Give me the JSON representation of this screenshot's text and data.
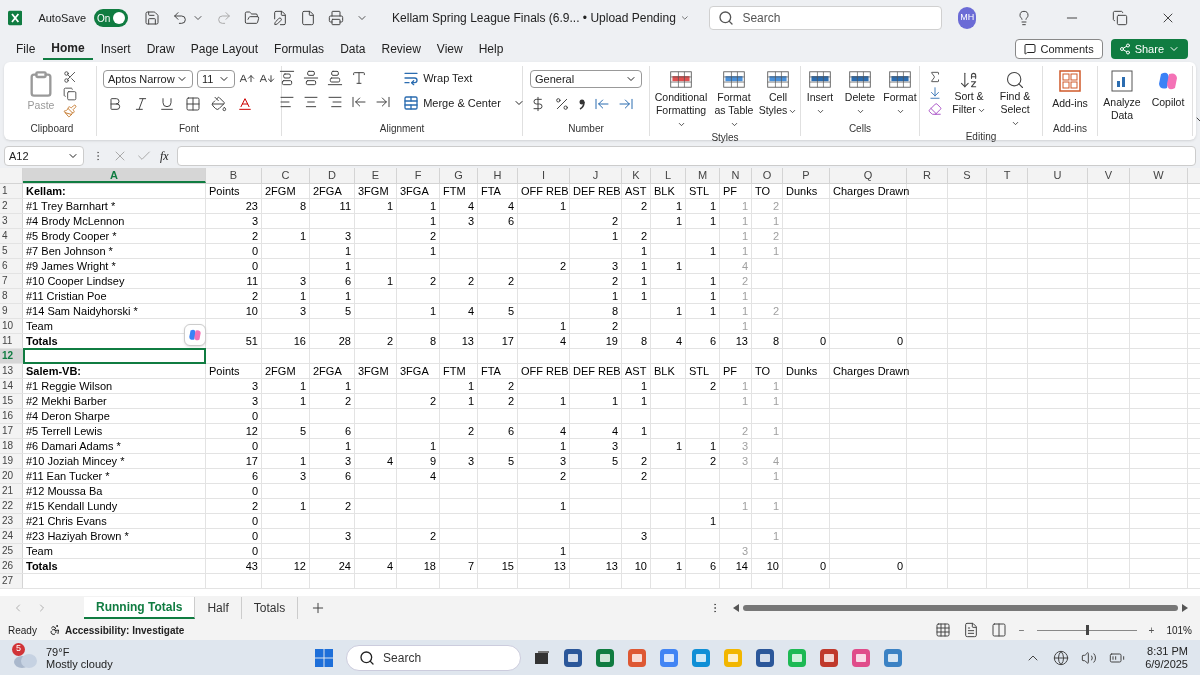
{
  "window": {
    "title": "Kellam Spring League Finals (6.9... • Upload Pending",
    "autosave": {
      "label": "AutoSave",
      "on": true,
      "state_label": "On"
    },
    "search": {
      "placeholder": "Search"
    },
    "user_initials": "MH"
  },
  "menu": [
    {
      "label": "File",
      "selected": false
    },
    {
      "label": "Home",
      "selected": true
    },
    {
      "label": "Insert",
      "selected": false
    },
    {
      "label": "Draw",
      "selected": false
    },
    {
      "label": "Page Layout",
      "selected": false
    },
    {
      "label": "Formulas",
      "selected": false
    },
    {
      "label": "Data",
      "selected": false
    },
    {
      "label": "Review",
      "selected": false
    },
    {
      "label": "View",
      "selected": false
    },
    {
      "label": "Help",
      "selected": false
    }
  ],
  "menu_buttons": {
    "comments": "Comments",
    "share": "Share"
  },
  "ribbon": {
    "groups": [
      {
        "kind": "clipboard",
        "label": "Clipboard",
        "paste": "Paste"
      },
      {
        "kind": "font",
        "label": "Font",
        "font_name": "Aptos Narrow",
        "font_size": "11"
      },
      {
        "kind": "alignment",
        "label": "Alignment",
        "wrap": "Wrap Text",
        "merge": "Merge & Center"
      },
      {
        "kind": "number",
        "label": "Number",
        "format": "General"
      },
      {
        "kind": "styles",
        "label": "Styles",
        "buttons": [
          "Conditional Formatting",
          "Format as Table",
          "Cell Styles"
        ]
      },
      {
        "kind": "cells",
        "label": "Cells",
        "buttons": [
          "Insert",
          "Delete",
          "Format"
        ]
      },
      {
        "kind": "editing",
        "label": "Editing",
        "buttons": [
          "Sort & Filter",
          "Find & Select"
        ]
      },
      {
        "kind": "addins",
        "label": "Add-ins",
        "buttons": [
          "Add-ins"
        ]
      },
      {
        "kind": "copilot",
        "buttons": [
          "Analyze Data",
          "Copilot"
        ]
      }
    ]
  },
  "formula_bar": {
    "name_box": "A12",
    "fx": "fx"
  },
  "columns": [
    {
      "letter": "A",
      "selected": true
    },
    {
      "letter": "B",
      "selected": false
    },
    {
      "letter": "C",
      "selected": false
    },
    {
      "letter": "D",
      "selected": false
    },
    {
      "letter": "E",
      "selected": false
    },
    {
      "letter": "F",
      "selected": false
    },
    {
      "letter": "G",
      "selected": false
    },
    {
      "letter": "H",
      "selected": false
    },
    {
      "letter": "I",
      "selected": false
    },
    {
      "letter": "J",
      "selected": false
    },
    {
      "letter": "K",
      "selected": false
    },
    {
      "letter": "L",
      "selected": false
    },
    {
      "letter": "M",
      "selected": false
    },
    {
      "letter": "N",
      "selected": false
    },
    {
      "letter": "O",
      "selected": false
    },
    {
      "letter": "P",
      "selected": false
    },
    {
      "letter": "Q",
      "selected": false
    },
    {
      "letter": "R",
      "selected": false
    },
    {
      "letter": "S",
      "selected": false
    },
    {
      "letter": "T",
      "selected": false
    },
    {
      "letter": "U",
      "selected": false
    },
    {
      "letter": "V",
      "selected": false
    },
    {
      "letter": "W",
      "selected": false
    }
  ],
  "rows": [
    {
      "n": "1",
      "kind": "header",
      "selected": false,
      "cells": [
        {
          "text": "Kellam:",
          "dim": false
        },
        {
          "text": "Points",
          "dim": false
        },
        {
          "text": "2FGM",
          "dim": false
        },
        {
          "text": "2FGA",
          "dim": false
        },
        {
          "text": "3FGM",
          "dim": false
        },
        {
          "text": "3FGA",
          "dim": false
        },
        {
          "text": "FTM",
          "dim": false
        },
        {
          "text": "FTA",
          "dim": false
        },
        {
          "text": "OFF REB",
          "dim": false
        },
        {
          "text": "DEF REB",
          "dim": false
        },
        {
          "text": "AST",
          "dim": false
        },
        {
          "text": "BLK",
          "dim": false
        },
        {
          "text": "STL",
          "dim": false
        },
        {
          "text": "PF",
          "dim": false
        },
        {
          "text": "TO",
          "dim": false
        },
        {
          "text": "Dunks",
          "dim": false
        },
        {
          "text": "Charges Drawn",
          "dim": false
        }
      ]
    },
    {
      "n": "2",
      "kind": "player",
      "selected": false,
      "cells": [
        {
          "text": "#1 Trey Barnhart *",
          "dim": false
        },
        {
          "text": "23",
          "dim": false
        },
        {
          "text": "8",
          "dim": false
        },
        {
          "text": "11",
          "dim": false
        },
        {
          "text": "1",
          "dim": false
        },
        {
          "text": "1",
          "dim": false
        },
        {
          "text": "4",
          "dim": false
        },
        {
          "text": "4",
          "dim": false
        },
        {
          "text": "1",
          "dim": false
        },
        null,
        {
          "text": "2",
          "dim": false
        },
        {
          "text": "1",
          "dim": false
        },
        {
          "text": "1",
          "dim": false
        },
        {
          "text": "1",
          "dim": true
        },
        {
          "text": "2",
          "dim": true
        }
      ]
    },
    {
      "n": "3",
      "kind": "player",
      "selected": false,
      "cells": [
        {
          "text": "#4 Brody McLennon",
          "dim": false
        },
        {
          "text": "3",
          "dim": false
        },
        null,
        null,
        null,
        {
          "text": "1",
          "dim": false
        },
        {
          "text": "3",
          "dim": false
        },
        {
          "text": "6",
          "dim": false
        },
        null,
        {
          "text": "2",
          "dim": false
        },
        null,
        {
          "text": "1",
          "dim": false
        },
        {
          "text": "1",
          "dim": false
        },
        {
          "text": "1",
          "dim": true
        },
        {
          "text": "1",
          "dim": true
        }
      ]
    },
    {
      "n": "4",
      "kind": "player",
      "selected": false,
      "cells": [
        {
          "text": "#5 Brody Cooper *",
          "dim": false
        },
        {
          "text": "2",
          "dim": false
        },
        {
          "text": "1",
          "dim": false
        },
        {
          "text": "3",
          "dim": false
        },
        null,
        {
          "text": "2",
          "dim": false
        },
        null,
        null,
        null,
        {
          "text": "1",
          "dim": false
        },
        {
          "text": "2",
          "dim": false
        },
        null,
        null,
        {
          "text": "1",
          "dim": true
        },
        {
          "text": "2",
          "dim": true
        }
      ]
    },
    {
      "n": "5",
      "kind": "player",
      "selected": false,
      "cells": [
        {
          "text": "#7 Ben Johnson *",
          "dim": false
        },
        {
          "text": "0",
          "dim": false
        },
        null,
        {
          "text": "1",
          "dim": false
        },
        null,
        {
          "text": "1",
          "dim": false
        },
        null,
        null,
        null,
        null,
        {
          "text": "1",
          "dim": false
        },
        null,
        {
          "text": "1",
          "dim": false
        },
        {
          "text": "1",
          "dim": true
        },
        {
          "text": "1",
          "dim": true
        }
      ]
    },
    {
      "n": "6",
      "kind": "player",
      "selected": false,
      "cells": [
        {
          "text": "#9 James Wright *",
          "dim": false
        },
        {
          "text": "0",
          "dim": false
        },
        null,
        {
          "text": "1",
          "dim": false
        },
        null,
        null,
        null,
        null,
        {
          "text": "2",
          "dim": false
        },
        {
          "text": "3",
          "dim": false
        },
        {
          "text": "1",
          "dim": false
        },
        {
          "text": "1",
          "dim": false
        },
        null,
        {
          "text": "4",
          "dim": true
        }
      ]
    },
    {
      "n": "7",
      "kind": "player",
      "selected": false,
      "cells": [
        {
          "text": "#10 Cooper Lindsey",
          "dim": false
        },
        {
          "text": "11",
          "dim": false
        },
        {
          "text": "3",
          "dim": false
        },
        {
          "text": "6",
          "dim": false
        },
        {
          "text": "1",
          "dim": false
        },
        {
          "text": "2",
          "dim": false
        },
        {
          "text": "2",
          "dim": false
        },
        {
          "text": "2",
          "dim": false
        },
        null,
        {
          "text": "2",
          "dim": false
        },
        {
          "text": "1",
          "dim": false
        },
        null,
        {
          "text": "1",
          "dim": false
        },
        {
          "text": "2",
          "dim": true
        }
      ]
    },
    {
      "n": "8",
      "kind": "player",
      "selected": false,
      "cells": [
        {
          "text": "#11 Cristian Poe",
          "dim": false
        },
        {
          "text": "2",
          "dim": false
        },
        {
          "text": "1",
          "dim": false
        },
        {
          "text": "1",
          "dim": false
        },
        null,
        null,
        null,
        null,
        null,
        {
          "text": "1",
          "dim": false
        },
        {
          "text": "1",
          "dim": false
        },
        null,
        {
          "text": "1",
          "dim": false
        },
        {
          "text": "1",
          "dim": true
        }
      ]
    },
    {
      "n": "9",
      "kind": "player",
      "selected": false,
      "cells": [
        {
          "text": "#14 Sam Naidyhorski *",
          "dim": false
        },
        {
          "text": "10",
          "dim": false
        },
        {
          "text": "3",
          "dim": false
        },
        {
          "text": "5",
          "dim": false
        },
        null,
        {
          "text": "1",
          "dim": false
        },
        {
          "text": "4",
          "dim": false
        },
        {
          "text": "5",
          "dim": false
        },
        null,
        {
          "text": "8",
          "dim": false
        },
        null,
        {
          "text": "1",
          "dim": false
        },
        {
          "text": "1",
          "dim": false
        },
        {
          "text": "1",
          "dim": true
        },
        {
          "text": "2",
          "dim": true
        }
      ]
    },
    {
      "n": "10",
      "kind": "player",
      "selected": false,
      "cells": [
        {
          "text": "Team",
          "dim": false
        },
        null,
        null,
        null,
        null,
        null,
        null,
        null,
        {
          "text": "1",
          "dim": false
        },
        {
          "text": "2",
          "dim": false
        },
        null,
        null,
        null,
        {
          "text": "1",
          "dim": true
        }
      ]
    },
    {
      "n": "11",
      "kind": "totals",
      "selected": false,
      "cells": [
        {
          "text": "Totals",
          "dim": false
        },
        {
          "text": "51",
          "dim": false
        },
        {
          "text": "16",
          "dim": false
        },
        {
          "text": "28",
          "dim": false
        },
        {
          "text": "2",
          "dim": false
        },
        {
          "text": "8",
          "dim": false
        },
        {
          "text": "13",
          "dim": false
        },
        {
          "text": "17",
          "dim": false
        },
        {
          "text": "4",
          "dim": false
        },
        {
          "text": "19",
          "dim": false
        },
        {
          "text": "8",
          "dim": false
        },
        {
          "text": "4",
          "dim": false
        },
        {
          "text": "6",
          "dim": false
        },
        {
          "text": "13",
          "dim": false
        },
        {
          "text": "8",
          "dim": false
        },
        {
          "text": "0",
          "dim": false
        },
        {
          "text": "0",
          "dim": false
        }
      ]
    },
    {
      "n": "12",
      "kind": "blank",
      "selected": true
    },
    {
      "n": "13",
      "kind": "header",
      "selected": false,
      "cells": [
        {
          "text": "Salem-VB:",
          "dim": false
        },
        {
          "text": "Points",
          "dim": false
        },
        {
          "text": "2FGM",
          "dim": false
        },
        {
          "text": "2FGA",
          "dim": false
        },
        {
          "text": "3FGM",
          "dim": false
        },
        {
          "text": "3FGA",
          "dim": false
        },
        {
          "text": "FTM",
          "dim": false
        },
        {
          "text": "FTA",
          "dim": false
        },
        {
          "text": "OFF REB",
          "dim": false
        },
        {
          "text": "DEF REB",
          "dim": false
        },
        {
          "text": "AST",
          "dim": false
        },
        {
          "text": "BLK",
          "dim": false
        },
        {
          "text": "STL",
          "dim": false
        },
        {
          "text": "PF",
          "dim": false
        },
        {
          "text": "TO",
          "dim": false
        },
        {
          "text": "Dunks",
          "dim": false
        },
        {
          "text": "Charges Drawn",
          "dim": false
        }
      ]
    },
    {
      "n": "14",
      "kind": "player",
      "selected": false,
      "cells": [
        {
          "text": "#1 Reggie Wilson",
          "dim": false
        },
        {
          "text": "3",
          "dim": false
        },
        {
          "text": "1",
          "dim": false
        },
        {
          "text": "1",
          "dim": false
        },
        null,
        null,
        {
          "text": "1",
          "dim": false
        },
        {
          "text": "2",
          "dim": false
        },
        null,
        null,
        {
          "text": "1",
          "dim": false
        },
        null,
        {
          "text": "2",
          "dim": false
        },
        {
          "text": "1",
          "dim": true
        },
        {
          "text": "1",
          "dim": true
        }
      ]
    },
    {
      "n": "15",
      "kind": "player",
      "selected": false,
      "cells": [
        {
          "text": "#2 Mekhi Barber",
          "dim": false
        },
        {
          "text": "3",
          "dim": false
        },
        {
          "text": "1",
          "dim": false
        },
        {
          "text": "2",
          "dim": false
        },
        null,
        {
          "text": "2",
          "dim": false
        },
        {
          "text": "1",
          "dim": false
        },
        {
          "text": "2",
          "dim": false
        },
        {
          "text": "1",
          "dim": false
        },
        {
          "text": "1",
          "dim": false
        },
        {
          "text": "1",
          "dim": false
        },
        null,
        null,
        {
          "text": "1",
          "dim": true
        },
        {
          "text": "1",
          "dim": true
        }
      ]
    },
    {
      "n": "16",
      "kind": "player",
      "selected": false,
      "cells": [
        {
          "text": "#4 Deron Sharpe",
          "dim": false
        },
        {
          "text": "0",
          "dim": false
        }
      ]
    },
    {
      "n": "17",
      "kind": "player",
      "selected": false,
      "cells": [
        {
          "text": "#5 Terrell Lewis",
          "dim": false
        },
        {
          "text": "12",
          "dim": false
        },
        {
          "text": "5",
          "dim": false
        },
        {
          "text": "6",
          "dim": false
        },
        null,
        null,
        {
          "text": "2",
          "dim": false
        },
        {
          "text": "6",
          "dim": false
        },
        {
          "text": "4",
          "dim": false
        },
        {
          "text": "4",
          "dim": false
        },
        {
          "text": "1",
          "dim": false
        },
        null,
        null,
        {
          "text": "2",
          "dim": true
        },
        {
          "text": "1",
          "dim": true
        }
      ]
    },
    {
      "n": "18",
      "kind": "player",
      "selected": false,
      "cells": [
        {
          "text": "#6 Damari Adams *",
          "dim": false
        },
        {
          "text": "0",
          "dim": false
        },
        null,
        {
          "text": "1",
          "dim": false
        },
        null,
        {
          "text": "1",
          "dim": false
        },
        null,
        null,
        {
          "text": "1",
          "dim": false
        },
        {
          "text": "3",
          "dim": false
        },
        null,
        {
          "text": "1",
          "dim": false
        },
        {
          "text": "1",
          "dim": false
        },
        {
          "text": "3",
          "dim": true
        }
      ]
    },
    {
      "n": "19",
      "kind": "player",
      "selected": false,
      "cells": [
        {
          "text": "#10 Joziah Mincey *",
          "dim": false
        },
        {
          "text": "17",
          "dim": false
        },
        {
          "text": "1",
          "dim": false
        },
        {
          "text": "3",
          "dim": false
        },
        {
          "text": "4",
          "dim": false
        },
        {
          "text": "9",
          "dim": false
        },
        {
          "text": "3",
          "dim": false
        },
        {
          "text": "5",
          "dim": false
        },
        {
          "text": "3",
          "dim": false
        },
        {
          "text": "5",
          "dim": false
        },
        {
          "text": "2",
          "dim": false
        },
        null,
        {
          "text": "2",
          "dim": false
        },
        {
          "text": "3",
          "dim": true
        },
        {
          "text": "4",
          "dim": true
        }
      ]
    },
    {
      "n": "20",
      "kind": "player",
      "selected": false,
      "cells": [
        {
          "text": "#11 Ean Tucker *",
          "dim": false
        },
        {
          "text": "6",
          "dim": false
        },
        {
          "text": "3",
          "dim": false
        },
        {
          "text": "6",
          "dim": false
        },
        null,
        {
          "text": "4",
          "dim": false
        },
        null,
        null,
        {
          "text": "2",
          "dim": false
        },
        null,
        {
          "text": "2",
          "dim": false
        },
        null,
        null,
        null,
        {
          "text": "1",
          "dim": true
        }
      ]
    },
    {
      "n": "21",
      "kind": "player",
      "selected": false,
      "cells": [
        {
          "text": "#12 Moussa Ba",
          "dim": false
        },
        {
          "text": "0",
          "dim": false
        }
      ]
    },
    {
      "n": "22",
      "kind": "player",
      "selected": false,
      "cells": [
        {
          "text": "#15 Kendall Lundy",
          "dim": false
        },
        {
          "text": "2",
          "dim": false
        },
        {
          "text": "1",
          "dim": false
        },
        {
          "text": "2",
          "dim": false
        },
        null,
        null,
        null,
        null,
        {
          "text": "1",
          "dim": false
        },
        null,
        null,
        null,
        null,
        {
          "text": "1",
          "dim": true
        },
        {
          "text": "1",
          "dim": true
        }
      ]
    },
    {
      "n": "23",
      "kind": "player",
      "selected": false,
      "cells": [
        {
          "text": "#21 Chris Evans",
          "dim": false
        },
        {
          "text": "0",
          "dim": false
        },
        null,
        null,
        null,
        null,
        null,
        null,
        null,
        null,
        null,
        null,
        {
          "text": "1",
          "dim": false
        }
      ]
    },
    {
      "n": "24",
      "kind": "player",
      "selected": false,
      "cells": [
        {
          "text": "#23 Haziyah Brown *",
          "dim": false
        },
        {
          "text": "0",
          "dim": false
        },
        null,
        {
          "text": "3",
          "dim": false
        },
        null,
        {
          "text": "2",
          "dim": false
        },
        null,
        null,
        null,
        null,
        {
          "text": "3",
          "dim": false
        },
        null,
        null,
        null,
        {
          "text": "1",
          "dim": true
        }
      ]
    },
    {
      "n": "25",
      "kind": "player",
      "selected": false,
      "cells": [
        {
          "text": "Team",
          "dim": false
        },
        {
          "text": "0",
          "dim": false
        },
        null,
        null,
        null,
        null,
        null,
        null,
        {
          "text": "1",
          "dim": false
        },
        null,
        null,
        null,
        null,
        {
          "text": "3",
          "dim": true
        }
      ]
    },
    {
      "n": "26",
      "kind": "totals",
      "selected": false,
      "cells": [
        {
          "text": "Totals",
          "dim": false
        },
        {
          "text": "43",
          "dim": false
        },
        {
          "text": "12",
          "dim": false
        },
        {
          "text": "24",
          "dim": false
        },
        {
          "text": "4",
          "dim": false
        },
        {
          "text": "18",
          "dim": false
        },
        {
          "text": "7",
          "dim": false
        },
        {
          "text": "15",
          "dim": false
        },
        {
          "text": "13",
          "dim": false
        },
        {
          "text": "13",
          "dim": false
        },
        {
          "text": "10",
          "dim": false
        },
        {
          "text": "1",
          "dim": false
        },
        {
          "text": "6",
          "dim": false
        },
        {
          "text": "14",
          "dim": false
        },
        {
          "text": "10",
          "dim": false
        },
        {
          "text": "0",
          "dim": false
        },
        {
          "text": "0",
          "dim": false
        }
      ]
    },
    {
      "n": "27",
      "kind": "blank",
      "selected": false
    }
  ],
  "sheet_tabs": [
    {
      "label": "Running Totals",
      "selected": true
    },
    {
      "label": "Half",
      "selected": false
    },
    {
      "label": "Totals",
      "selected": false
    }
  ],
  "status_bar": {
    "status": "Ready",
    "accessibility": "Accessibility: Investigate",
    "zoom": {
      "level": 0.5,
      "reading": "101%",
      "minus": "−",
      "plus": "+"
    }
  },
  "taskbar": {
    "weather": {
      "badge": "5",
      "temperature": "79°F",
      "condition": "Mostly cloudy"
    },
    "search": {
      "placeholder": "Search"
    },
    "time": "8:31 PM",
    "date": "6/9/2025"
  }
}
